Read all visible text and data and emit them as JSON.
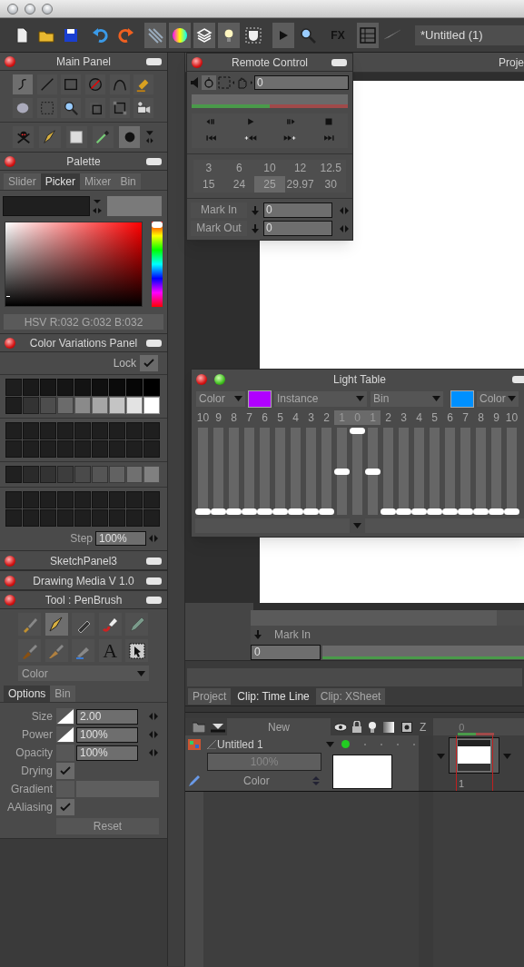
{
  "toolbar": [
    {
      "kind": "new-doc",
      "selected": false
    },
    {
      "kind": "open",
      "selected": false
    },
    {
      "kind": "save",
      "selected": false
    },
    {
      "kind": "undo",
      "selected": false
    },
    {
      "kind": "redo",
      "selected": false
    },
    {
      "kind": "pencils",
      "selected": true
    },
    {
      "kind": "color-wheel",
      "selected": true
    },
    {
      "kind": "layers",
      "selected": true
    },
    {
      "kind": "bulb",
      "selected": true
    },
    {
      "kind": "mask",
      "selected": false
    },
    {
      "kind": "play",
      "selected": true
    },
    {
      "kind": "zoom",
      "selected": false
    },
    {
      "kind": "fx",
      "label": "FX",
      "selected": false
    },
    {
      "kind": "grid",
      "selected": true
    },
    {
      "kind": "plane",
      "selected": false
    }
  ],
  "document_field": "*Untitled (1)",
  "main_panel": {
    "title": "Main Panel",
    "tools": [
      {
        "kind": "stroke",
        "selected": true
      },
      {
        "kind": "line",
        "selected": false
      },
      {
        "kind": "rect",
        "selected": false
      },
      {
        "kind": "ellipse",
        "selected": false
      },
      {
        "kind": "curve",
        "selected": false
      },
      {
        "kind": "fill",
        "selected": false
      },
      {
        "kind": "blur",
        "selected": false
      },
      {
        "kind": "selection",
        "selected": false
      },
      {
        "kind": "zoom",
        "selected": false
      },
      {
        "kind": "crop",
        "selected": false
      },
      {
        "kind": "transform",
        "selected": false
      },
      {
        "kind": "camera",
        "selected": false
      }
    ],
    "media": [
      {
        "kind": "skull",
        "selected": false
      },
      {
        "kind": "pen",
        "selected": false
      },
      {
        "kind": "paper",
        "selected": false
      },
      {
        "kind": "dropper",
        "selected": false
      },
      {
        "kind": "dot",
        "selected": true
      }
    ]
  },
  "palette": {
    "title": "Palette",
    "tabs": [
      {
        "label": "Slider",
        "selected": false
      },
      {
        "label": "Picker",
        "selected": true
      },
      {
        "label": "Mixer",
        "selected": false
      },
      {
        "label": "Bin",
        "selected": false
      }
    ],
    "readout": "HSV R:032 G:032 B:032",
    "hue": {
      "level": 1
    }
  },
  "color_variations": {
    "title": "Color Variations Panel",
    "lock_label": "Lock",
    "locked": true,
    "groups": [
      [
        [
          {
            "color": "#1e1e1e"
          },
          {
            "color": "#1a1a1a"
          },
          {
            "color": "#171717"
          },
          {
            "color": "#151515"
          },
          {
            "color": "#131313"
          },
          {
            "color": "#101010"
          },
          {
            "color": "#0b0b0b"
          },
          {
            "color": "#060606"
          },
          {
            "color": "#000000"
          }
        ],
        [
          {
            "color": "#1e1e1e"
          },
          {
            "color": "#333333"
          },
          {
            "color": "#4d4d4d"
          },
          {
            "color": "#6b6b6b"
          },
          {
            "color": "#8a8a8a"
          },
          {
            "color": "#a6a6a6"
          },
          {
            "color": "#c4c4c4"
          },
          {
            "color": "#e3e3e3"
          },
          {
            "color": "#ffffff"
          }
        ]
      ],
      [
        [
          {
            "color": "#1f1f1f"
          },
          {
            "color": "#1f1f1f"
          },
          {
            "color": "#1f1f1f"
          },
          {
            "color": "#1f1f1f"
          },
          {
            "color": "#1f1f1f"
          },
          {
            "color": "#1f1f1f"
          },
          {
            "color": "#1f1f1f"
          },
          {
            "color": "#1f1f1f"
          },
          {
            "color": "#1f1f1f"
          }
        ],
        [
          {
            "color": "#1f1f1f"
          },
          {
            "color": "#1f1f1f"
          },
          {
            "color": "#1f1f1f"
          },
          {
            "color": "#1f1f1f"
          },
          {
            "color": "#1f1f1f"
          },
          {
            "color": "#1f1f1f"
          },
          {
            "color": "#1f1f1f"
          },
          {
            "color": "#1f1f1f"
          },
          {
            "color": "#1f1f1f"
          }
        ]
      ],
      [
        [
          {
            "color": "#202020"
          },
          {
            "color": "#2a2a2a"
          },
          {
            "color": "#333333"
          },
          {
            "color": "#3d3d3d"
          },
          {
            "color": "#4a4a4a"
          },
          {
            "color": "#555555"
          },
          {
            "color": "#626262"
          },
          {
            "color": "#707070"
          },
          {
            "color": "#808080"
          }
        ]
      ],
      [
        [
          {
            "color": "#1f1f1f"
          },
          {
            "color": "#1f1f1f"
          },
          {
            "color": "#1f1f1f"
          },
          {
            "color": "#1f1f1f"
          },
          {
            "color": "#1f1f1f"
          },
          {
            "color": "#1f1f1f"
          },
          {
            "color": "#1f1f1f"
          },
          {
            "color": "#1f1f1f"
          },
          {
            "color": "#1f1f1f"
          }
        ],
        [
          {
            "color": "#1f1f1f"
          },
          {
            "color": "#1f1f1f"
          },
          {
            "color": "#1f1f1f"
          },
          {
            "color": "#1f1f1f"
          },
          {
            "color": "#1f1f1f"
          },
          {
            "color": "#1f1f1f"
          },
          {
            "color": "#1f1f1f"
          },
          {
            "color": "#1f1f1f"
          },
          {
            "color": "#1f1f1f"
          }
        ]
      ]
    ],
    "step_label": "Step",
    "step_value": "100%"
  },
  "collapsed_panels": [
    {
      "title": "SketchPanel3"
    },
    {
      "title": "Drawing Media V 1.0"
    }
  ],
  "tool_panel": {
    "title": "Tool : PenBrush",
    "tools": [
      {
        "kind": "flat-brush",
        "selected": false
      },
      {
        "kind": "pen",
        "selected": true
      },
      {
        "kind": "marker",
        "selected": false
      },
      {
        "kind": "tube",
        "selected": false
      },
      {
        "kind": "pencil",
        "selected": false
      },
      {
        "kind": "oil-brush",
        "selected": false
      },
      {
        "kind": "fan-brush",
        "selected": false
      },
      {
        "kind": "airbrush",
        "selected": false
      },
      {
        "kind": "text",
        "label": "A",
        "selected": false
      },
      {
        "kind": "pointer",
        "selected": false
      }
    ],
    "mode": "Color",
    "tabs": [
      {
        "label": "Options",
        "selected": true
      },
      {
        "label": "Bin",
        "selected": false
      }
    ],
    "options": [
      {
        "kind": "number",
        "label": "Size",
        "value": "2.00",
        "pressure": true
      },
      {
        "kind": "number",
        "label": "Power",
        "value": "100%",
        "pressure": true
      },
      {
        "kind": "number",
        "label": "Opacity",
        "value": "100%",
        "pressure": false
      },
      {
        "kind": "check",
        "label": "Drying",
        "checked": true
      },
      {
        "kind": "gradient",
        "label": "Gradient"
      },
      {
        "kind": "check",
        "label": "AAliasing",
        "checked": true
      }
    ],
    "reset": "Reset"
  },
  "project_window": {
    "title": "Proje",
    "mark_in_label": "Mark In",
    "mark_in_value": "0"
  },
  "remote_control": {
    "title": "Remote Control",
    "counter": "0",
    "level": 0.5,
    "transport": [
      {
        "kind": "step-back"
      },
      {
        "kind": "play"
      },
      {
        "kind": "step-forward"
      },
      {
        "kind": "stop"
      },
      {
        "kind": "first"
      },
      {
        "kind": "add-back"
      },
      {
        "kind": "forward-add"
      },
      {
        "kind": "last"
      }
    ],
    "rates": [
      {
        "label": "3",
        "selected": false
      },
      {
        "label": "6",
        "selected": false
      },
      {
        "label": "10",
        "selected": false
      },
      {
        "label": "12",
        "selected": false
      },
      {
        "label": "12.5",
        "selected": false
      },
      {
        "label": "15",
        "selected": false
      },
      {
        "label": "24",
        "selected": false
      },
      {
        "label": "25",
        "selected": true
      },
      {
        "label": "29.97",
        "selected": false
      },
      {
        "label": "30",
        "selected": false
      }
    ],
    "marks": [
      {
        "label": "Mark In",
        "value": "0"
      },
      {
        "label": "Mark Out",
        "value": "0"
      }
    ]
  },
  "light_table": {
    "title": "Light Table",
    "left_mode": "Color",
    "instance": "Instance",
    "bin": "Bin",
    "right_mode": "Color",
    "onion_colors": [
      {
        "color": "#b000ff"
      },
      {
        "color": "#0090ff"
      }
    ],
    "sliders": [
      {
        "label": "10",
        "level": 0,
        "selected": false
      },
      {
        "label": "9",
        "level": 0,
        "selected": false
      },
      {
        "label": "8",
        "level": 0,
        "selected": false
      },
      {
        "label": "7",
        "level": 0,
        "selected": false
      },
      {
        "label": "6",
        "level": 0,
        "selected": false
      },
      {
        "label": "5",
        "level": 0,
        "selected": false
      },
      {
        "label": "4",
        "level": 0,
        "selected": false
      },
      {
        "label": "3",
        "level": 0,
        "selected": false
      },
      {
        "label": "2",
        "level": 0,
        "selected": false
      },
      {
        "label": "1",
        "level": 0.5,
        "selected": true
      },
      {
        "label": "0",
        "level": 1,
        "selected": true
      },
      {
        "label": "1",
        "level": 0.5,
        "selected": true
      },
      {
        "label": "2",
        "level": 0,
        "selected": false
      },
      {
        "label": "3",
        "level": 0,
        "selected": false
      },
      {
        "label": "4",
        "level": 0,
        "selected": false
      },
      {
        "label": "5",
        "level": 0,
        "selected": false
      },
      {
        "label": "6",
        "level": 0,
        "selected": false
      },
      {
        "label": "7",
        "level": 0,
        "selected": false
      },
      {
        "label": "8",
        "level": 0,
        "selected": false
      },
      {
        "label": "9",
        "level": 0,
        "selected": false
      },
      {
        "label": "10",
        "level": 0,
        "selected": false
      }
    ]
  },
  "timeline": {
    "tabs": [
      {
        "label": "Project",
        "selected": false
      },
      {
        "label": "Clip: Time Line",
        "selected": true
      },
      {
        "label": "Clip: XSheet",
        "selected": false
      }
    ],
    "new_label": "New",
    "z_label": "Z",
    "frame_header": "0",
    "layers": [
      {
        "name": "Untitled 1",
        "opacity": "100%",
        "blend": "Color",
        "visible": true,
        "frame": "1"
      }
    ]
  }
}
